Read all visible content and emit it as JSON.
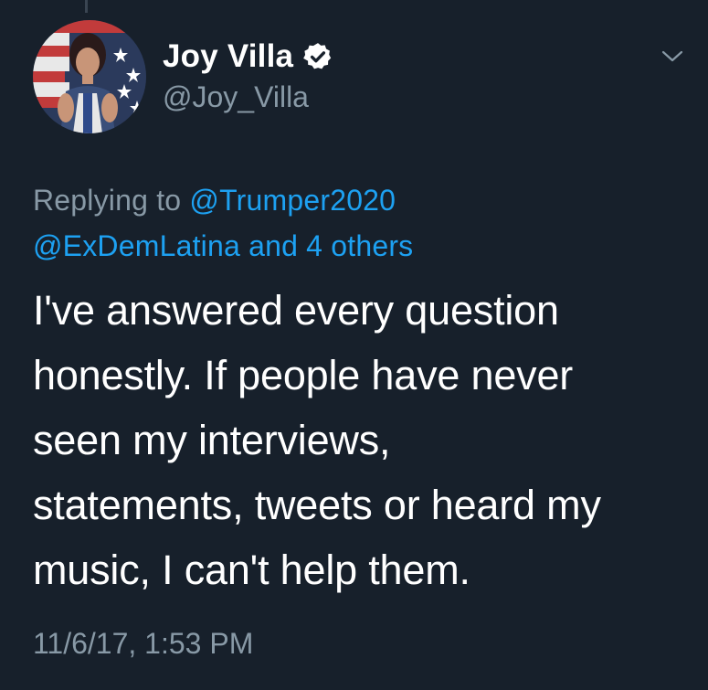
{
  "author": {
    "display_name": "Joy Villa",
    "handle": "@Joy_Villa",
    "verified": true,
    "avatar_icon": "profile-photo"
  },
  "reply_context": {
    "prefix": "Replying to ",
    "mention_1": "@Trumper2020",
    "mention_2": "@ExDemLatina",
    "suffix": " and 4 others"
  },
  "tweet": {
    "text": "I've answered every question\nhonestly. If people have never\nseen my interviews,\nstatements, tweets or heard my\nmusic, I can't help them.",
    "timestamp": "11/6/17, 1:53 PM"
  },
  "icons": {
    "verified": "verified-badge-icon",
    "caret": "chevron-down-icon"
  },
  "colors": {
    "background": "#17202b",
    "link": "#1da1f2",
    "muted": "#8899a6",
    "text": "#ffffff"
  }
}
